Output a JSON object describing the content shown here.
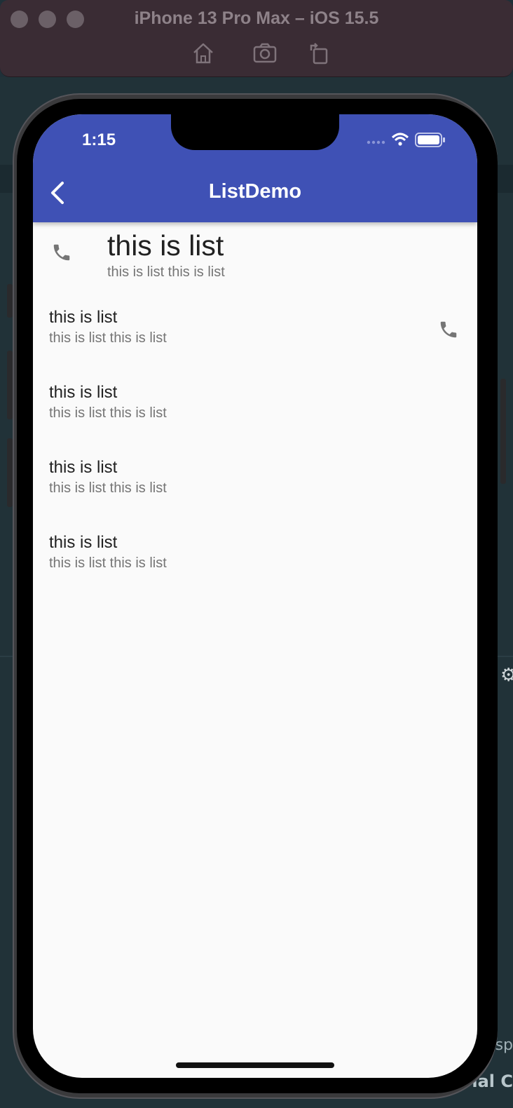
{
  "simulator": {
    "title": "iPhone 13 Pro Max – iOS 15.5"
  },
  "status_bar": {
    "time": "1:15"
  },
  "app_bar": {
    "title": "ListDemo",
    "back_icon": "chevron-left-icon",
    "color": "#3f51b5"
  },
  "list": {
    "items": [
      {
        "title": "this is list",
        "subtitle": "this is list this is list",
        "icon": "phone-icon",
        "icon_position": "leading"
      },
      {
        "title": "this is list",
        "subtitle": "this is list this is list",
        "icon": "phone-icon",
        "icon_position": "trailing"
      },
      {
        "title": "this is list",
        "subtitle": "this is list this is list"
      },
      {
        "title": "this is list",
        "subtitle": "this is list this is list"
      },
      {
        "title": "this is list",
        "subtitle": "this is list this is list"
      }
    ]
  },
  "background": {
    "text_1": "sp",
    "text_2": "rial C"
  }
}
